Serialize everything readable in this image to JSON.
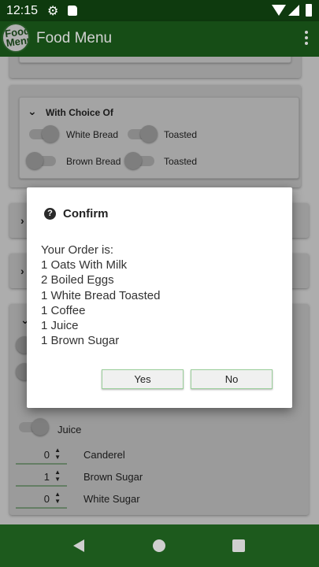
{
  "status_bar": {
    "time": "12:15",
    "icons": [
      "gear-icon",
      "sd-card-icon",
      "wifi-icon",
      "signal-icon",
      "battery-icon"
    ]
  },
  "app_bar": {
    "title": "Food Menu",
    "logo_text": "Food Menu"
  },
  "menu": {
    "choice_section": {
      "title": "With Choice Of",
      "options": [
        {
          "label": "White Bread",
          "on": true
        },
        {
          "label": "Toasted",
          "on": true
        },
        {
          "label": "Brown Bread",
          "on": false
        },
        {
          "label": "Toasted",
          "on": false
        }
      ]
    },
    "drinks": {
      "juice_label": "Juice"
    },
    "steppers": [
      {
        "value": "0",
        "label": "Canderel"
      },
      {
        "value": "1",
        "label": "Brown Sugar"
      },
      {
        "value": "0",
        "label": "White Sugar"
      }
    ]
  },
  "dialog": {
    "title": "Confirm",
    "lines": [
      "Your Order is:",
      "1 Oats With Milk",
      "2 Boiled Eggs",
      "1 White Bread Toasted",
      "1 Coffee",
      "1 Juice",
      "1 Brown Sugar"
    ],
    "yes_label": "Yes",
    "no_label": "No"
  },
  "colors": {
    "status_bar": "#0e3a0e",
    "app_bar": "#1b5e1b",
    "nav_bar": "#1d5a1d",
    "button_border": "#9bcf9b"
  }
}
